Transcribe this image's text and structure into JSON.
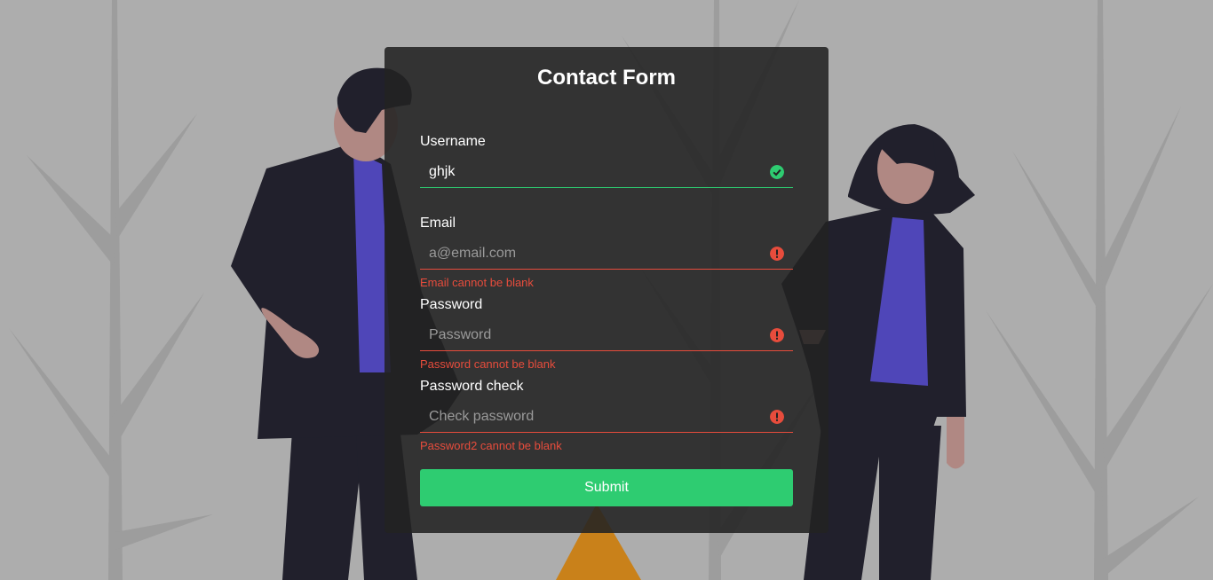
{
  "form": {
    "title": "Contact Form",
    "submit_label": "Submit",
    "fields": [
      {
        "label": "Username",
        "value": "ghjk",
        "placeholder": "",
        "status": "success",
        "error": ""
      },
      {
        "label": "Email",
        "value": "",
        "placeholder": "a@email.com",
        "status": "error",
        "error": "Email cannot be blank"
      },
      {
        "label": "Password",
        "value": "",
        "placeholder": "Password",
        "status": "error",
        "error": "Password cannot be blank"
      },
      {
        "label": "Password check",
        "value": "",
        "placeholder": "Check password",
        "status": "error",
        "error": "Password2 cannot be blank"
      }
    ]
  },
  "colors": {
    "success": "#2ecc71",
    "error": "#e74c3c",
    "background": "#adadad",
    "card": "#222222",
    "figure_dark": "#21202c",
    "figure_accent": "#4f46b8",
    "skin": "#b08883"
  },
  "icons": {
    "success": "check-circle-icon",
    "error": "exclamation-circle-icon"
  }
}
